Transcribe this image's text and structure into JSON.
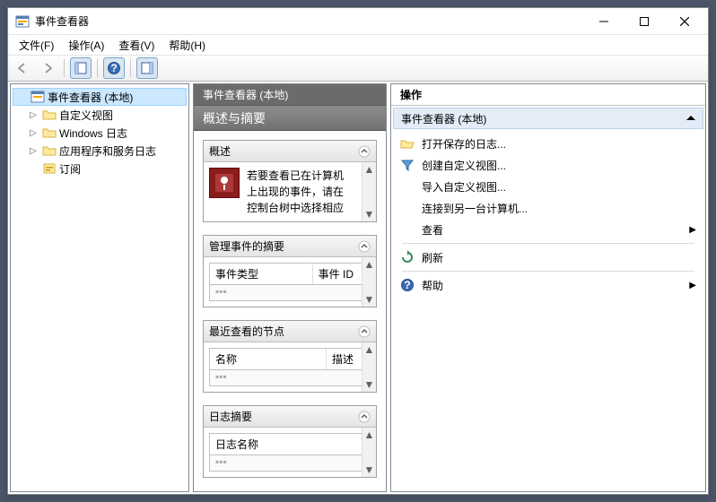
{
  "window": {
    "title": "事件查看器"
  },
  "menu": {
    "file": "文件(F)",
    "action": "操作(A)",
    "view": "查看(V)",
    "help": "帮助(H)"
  },
  "tree": {
    "root": "事件查看器 (本地)",
    "items": [
      {
        "label": "自定义视图",
        "expandable": true
      },
      {
        "label": "Windows 日志",
        "expandable": true
      },
      {
        "label": "应用程序和服务日志",
        "expandable": true
      },
      {
        "label": "订阅",
        "expandable": false
      }
    ]
  },
  "center": {
    "header": "事件查看器 (本地)",
    "subtitle": "概述与摘要",
    "sections": {
      "overview": {
        "title": "概述",
        "body_line1": "若要查看已在计算机",
        "body_line2": "上出现的事件，请在",
        "body_line3": "控制台树中选择相应"
      },
      "summary": {
        "title": "管理事件的摘要",
        "col1": "事件类型",
        "col2": "事件 ID"
      },
      "recent": {
        "title": "最近查看的节点",
        "col1": "名称",
        "col2": "描述"
      },
      "log": {
        "title": "日志摘要",
        "col1": "日志名称"
      }
    }
  },
  "actions": {
    "header": "操作",
    "group": "事件查看器 (本地)",
    "items": {
      "open_saved": "打开保存的日志...",
      "create_view": "创建自定义视图...",
      "import_view": "导入自定义视图...",
      "connect": "连接到另一台计算机...",
      "view": "查看",
      "refresh": "刷新",
      "help": "帮助"
    }
  }
}
